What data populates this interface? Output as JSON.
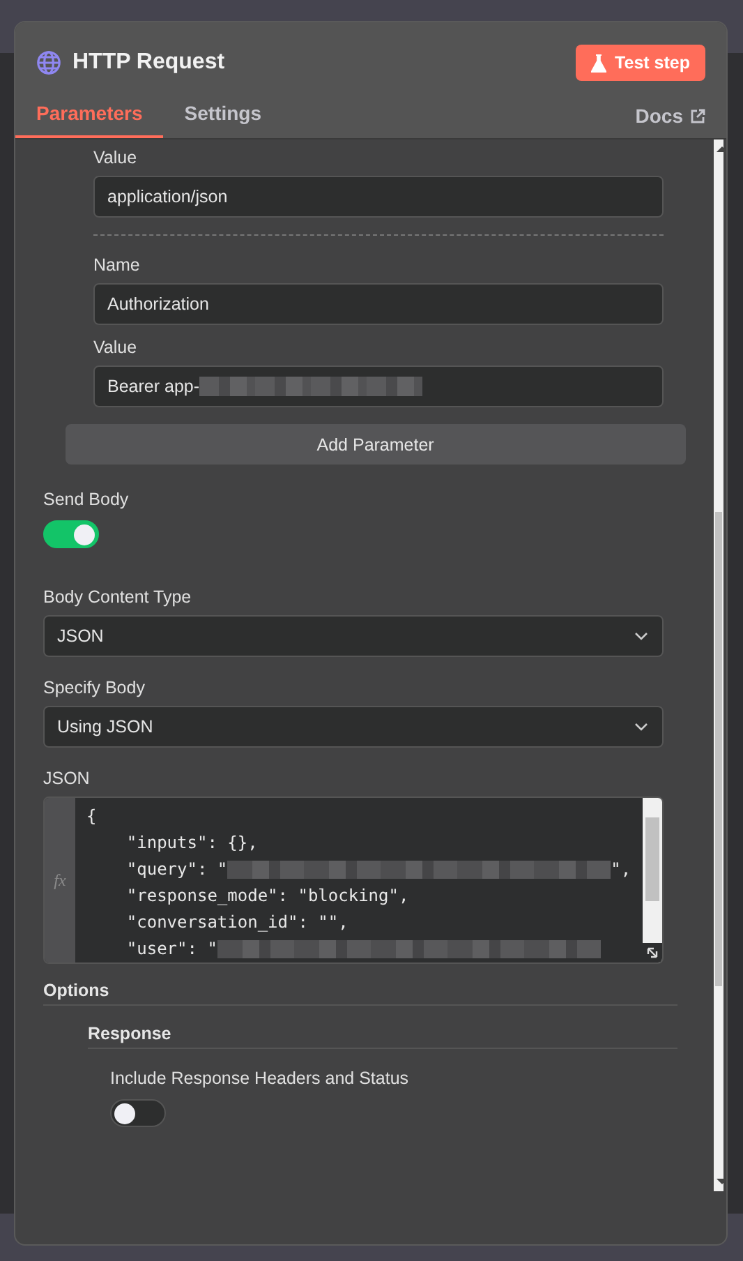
{
  "node": {
    "title": "HTTP Request",
    "action": "Test step"
  },
  "tabs": [
    {
      "label": "Parameters",
      "selected": true
    },
    {
      "label": "Settings",
      "selected": false
    }
  ],
  "docs_link": "Docs",
  "headers": [
    {
      "fields": [
        {
          "label": "Value",
          "value": "application/json",
          "redacted": false
        }
      ]
    },
    {
      "fields": [
        {
          "label": "Name",
          "value": "Authorization",
          "redacted": false
        },
        {
          "label": "Value",
          "value": "Bearer app-",
          "redacted": true
        }
      ]
    }
  ],
  "add_parameter": "Add Parameter",
  "send_body": {
    "label": "Send Body",
    "on": true
  },
  "body_content_type": {
    "label": "Body Content Type",
    "value": "JSON"
  },
  "specify_body": {
    "label": "Specify Body",
    "value": "Using JSON"
  },
  "json_editor": {
    "label": "JSON",
    "gutter": "fx",
    "lines": [
      {
        "text": "{",
        "redacted": false
      },
      {
        "text": "    \"inputs\": {},",
        "redacted": false
      },
      {
        "text": "    \"query\": \"",
        "redacted": true,
        "suffix": "\","
      },
      {
        "text": "    \"response_mode\": \"blocking\",",
        "redacted": false
      },
      {
        "text": "    \"conversation_id\": \"\",",
        "redacted": false
      },
      {
        "text": "    \"user\": \"",
        "redacted": true
      }
    ]
  },
  "options": {
    "title": "Options",
    "sections": [
      {
        "title": "Response",
        "toggles": [
          {
            "label": "Include Response Headers and Status",
            "on": false
          }
        ]
      }
    ]
  }
}
